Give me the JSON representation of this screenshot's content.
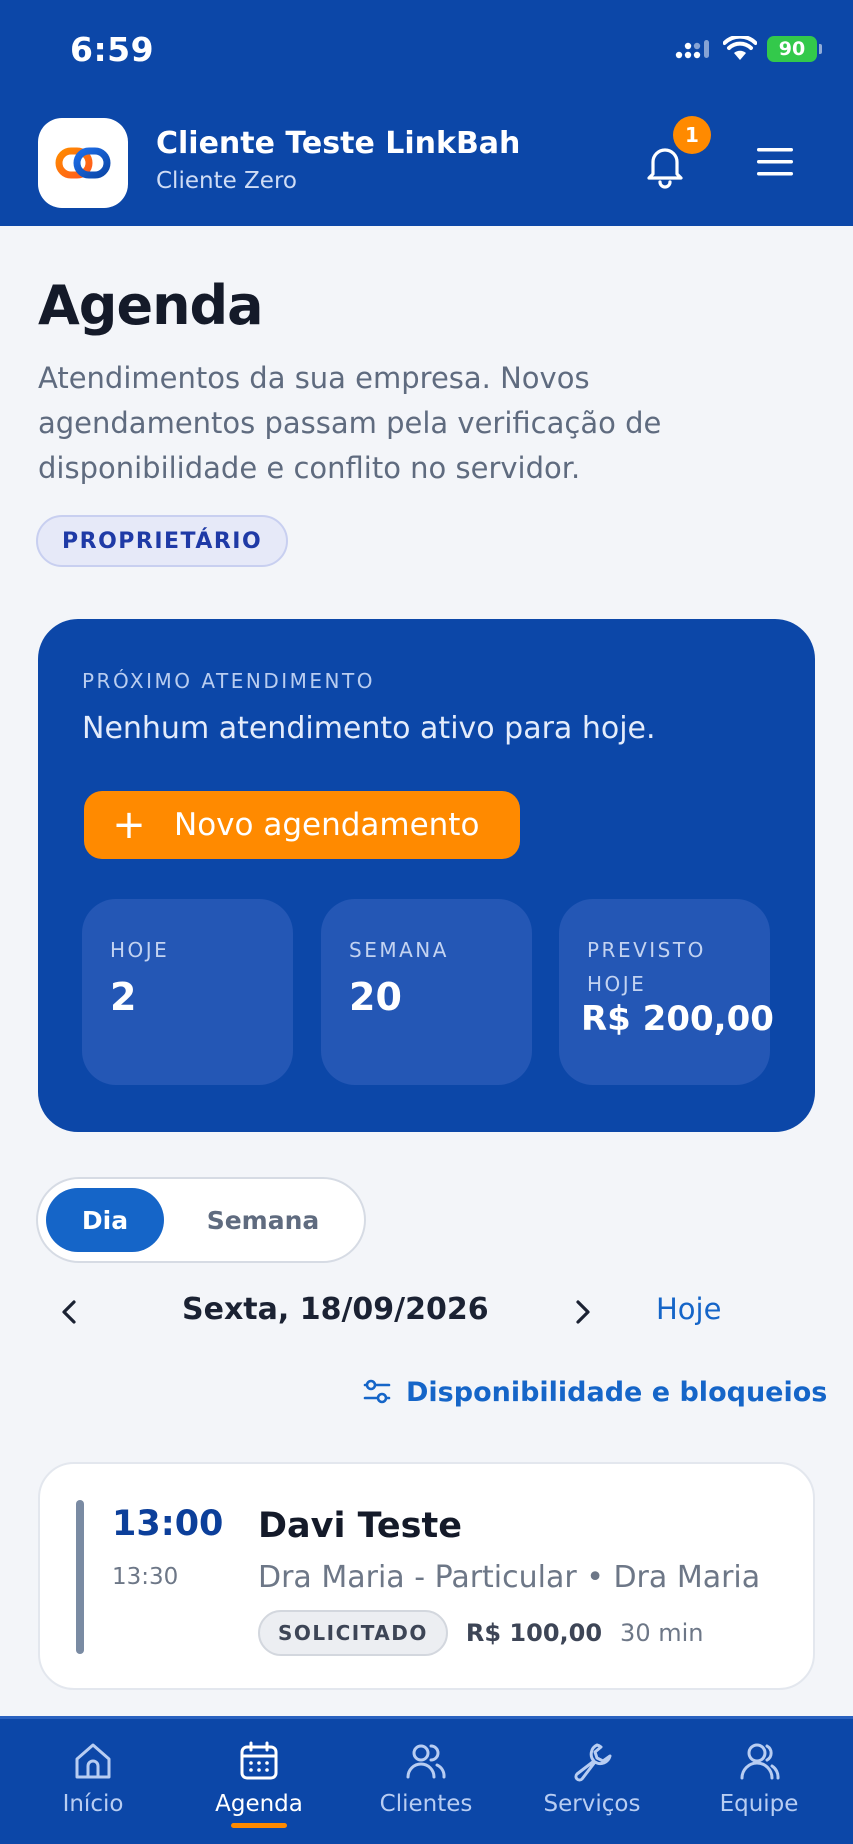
{
  "status_bar": {
    "time": "6:59",
    "battery": "90"
  },
  "app_bar": {
    "company_name": "Cliente Teste LinkBah",
    "company_subtitle": "Cliente Zero",
    "notification_count": "1"
  },
  "page": {
    "title": "Agenda",
    "description": "Atendimentos da sua empresa. Novos agendamentos passam pela verificação de disponibilidade e conflito no servidor.",
    "role": "PROPRIETÁRIO"
  },
  "summary": {
    "next_label": "PRÓXIMO ATENDIMENTO",
    "next_text": "Nenhum atendimento ativo para hoje.",
    "new_button": "Novo agendamento",
    "stats": [
      {
        "label": "HOJE",
        "value": "2"
      },
      {
        "label": "SEMANA",
        "value": "20"
      },
      {
        "label": "PREVISTO HOJE",
        "value": "R$ 200,00"
      }
    ]
  },
  "view_toggle": {
    "day": "Dia",
    "week": "Semana",
    "selected": "Dia"
  },
  "date_nav": {
    "date": "Sexta, 18/09/2026",
    "today": "Hoje"
  },
  "availability_link": "Disponibilidade e bloqueios",
  "appointments": [
    {
      "start": "13:00",
      "end": "13:30",
      "client": "Davi Teste",
      "description": "Dra Maria - Particular • Dra Maria",
      "status": "SOLICITADO",
      "price": "R$ 100,00",
      "duration": "30 min"
    }
  ],
  "tabs": [
    {
      "label": "Início",
      "icon": "home-icon"
    },
    {
      "label": "Agenda",
      "icon": "calendar-icon",
      "active": true
    },
    {
      "label": "Clientes",
      "icon": "users-icon"
    },
    {
      "label": "Serviços",
      "icon": "wrench-icon"
    },
    {
      "label": "Equipe",
      "icon": "team-icon"
    }
  ],
  "colors": {
    "primary": "#0c47a8",
    "accent": "#ff8a00",
    "link": "#1565c8",
    "background": "#f3f5f9"
  }
}
